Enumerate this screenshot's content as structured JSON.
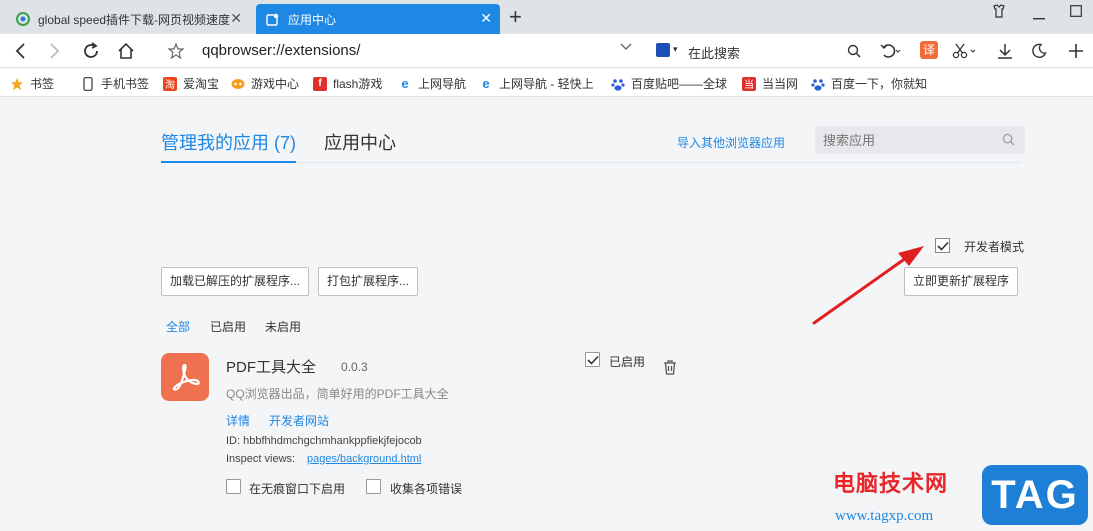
{
  "tabs": [
    {
      "title": "global speed插件下载-网页视频速度",
      "active": false,
      "icon": "browser-logo-icon"
    },
    {
      "title": "应用中心",
      "active": true,
      "icon": "puzzle-icon"
    }
  ],
  "navbar": {
    "url": "qqbrowser://extensions/",
    "search_placeholder": "在此搜索",
    "translate_label": "译"
  },
  "bookmarks": [
    {
      "label": "书签",
      "icon": "star-icon"
    },
    {
      "label": "手机书签",
      "icon": "phone-icon"
    },
    {
      "label": "爱淘宝",
      "icon": "taobao-icon"
    },
    {
      "label": "游戏中心",
      "icon": "game-icon"
    },
    {
      "label": "flash游戏",
      "icon": "flash-icon"
    },
    {
      "label": "上网导航",
      "icon": "ie-icon"
    },
    {
      "label": "上网导航 - 轻快上",
      "icon": "ie-icon"
    },
    {
      "label": "百度贴吧——全球",
      "icon": "baidu-icon"
    },
    {
      "label": "当当网",
      "icon": "dangdang-icon"
    },
    {
      "label": "百度一下，你就知",
      "icon": "baidu-icon"
    }
  ],
  "page": {
    "tab_manage": "管理我的应用 (7)",
    "tab_center": "应用中心",
    "import_link": "导入其他浏览器应用",
    "search_placeholder": "搜索应用",
    "dev_mode_label": "开发者模式",
    "dev_mode_checked": true,
    "load_unpacked": "加载已解压的扩展程序...",
    "pack_extension": "打包扩展程序...",
    "update_now": "立即更新扩展程序",
    "filters": [
      {
        "label": "全部",
        "active": true
      },
      {
        "label": "已启用",
        "active": false
      },
      {
        "label": "未启用",
        "active": false
      }
    ]
  },
  "extension": {
    "name": "PDF工具大全",
    "version": "0.0.3",
    "description": "QQ浏览器出品，简单好用的PDF工具大全",
    "details_link": "详情",
    "developer_site_link": "开发者网站",
    "id_line": "ID: hbbfhhdmchgchmhankppfiekjfejocob",
    "inspect_label": "Inspect views:",
    "inspect_link": "pages/background.html",
    "enabled_label": "已启用",
    "enabled": true,
    "incognito_label": "在无痕窗口下启用",
    "collect_errors_label": "收集各项错误"
  },
  "watermark": {
    "text": "电脑技术网",
    "tag": "TAG",
    "url": "www.tagxp.com"
  },
  "colors": {
    "accent": "#1e88e5",
    "arrow": "#e02020",
    "pdf_icon": "#f0714f"
  }
}
